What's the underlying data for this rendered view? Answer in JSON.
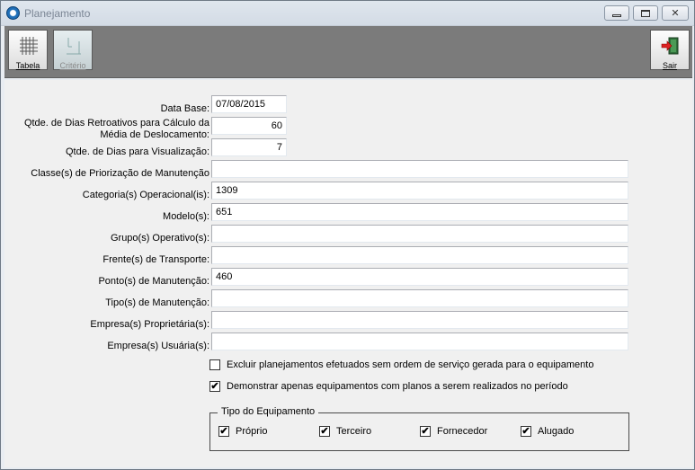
{
  "window": {
    "title": "Planejamento"
  },
  "toolbar": {
    "tabela_label": "Tabela",
    "criterio_label": "Critério",
    "sair_label": "Sair"
  },
  "form": {
    "data_base": {
      "label": "Data Base:",
      "value": "07/08/2015"
    },
    "dias_retro": {
      "label_line1": "Qtde. de Dias Retroativos para Cálculo da",
      "label_line2": "Média de Deslocamento:",
      "value": "60"
    },
    "dias_visual": {
      "label": "Qtde. de Dias para Visualização:",
      "value": "7"
    },
    "classes": {
      "label": "Classe(s) de Priorização de Manutenção",
      "value": ""
    },
    "categorias": {
      "label": "Categoria(s) Operacional(is):",
      "value": "1309"
    },
    "modelos": {
      "label": "Modelo(s):",
      "value": "651"
    },
    "grupos": {
      "label": "Grupo(s) Operativo(s):",
      "value": ""
    },
    "frentes": {
      "label": "Frente(s) de Transporte:",
      "value": ""
    },
    "pontos": {
      "label": "Ponto(s) de Manutenção:",
      "value": "460"
    },
    "tipos": {
      "label": "Tipo(s) de Manutenção:",
      "value": ""
    },
    "empresa_prop": {
      "label": "Empresa(s) Proprietária(s):",
      "value": ""
    },
    "empresa_usu": {
      "label": "Empresa(s) Usuária(s):",
      "value": ""
    }
  },
  "options": {
    "excluir": {
      "label": "Excluir planejamentos efetuados sem ordem de serviço gerada para o equipamento",
      "checked": false
    },
    "demonstrar": {
      "label": "Demonstrar apenas equipamentos com planos a serem realizados no período",
      "checked": true
    }
  },
  "tipo_equipamento": {
    "title": "Tipo do Equipamento",
    "items": [
      {
        "label": "Próprio",
        "checked": true
      },
      {
        "label": "Terceiro",
        "checked": true
      },
      {
        "label": "Fornecedor",
        "checked": true
      },
      {
        "label": "Alugado",
        "checked": true
      }
    ]
  },
  "check_glyph": "✔",
  "icons": {
    "app": "app-logo-icon",
    "tabela": "grid-table-icon",
    "criterio": "criteria-icon",
    "sair": "exit-door-icon"
  }
}
